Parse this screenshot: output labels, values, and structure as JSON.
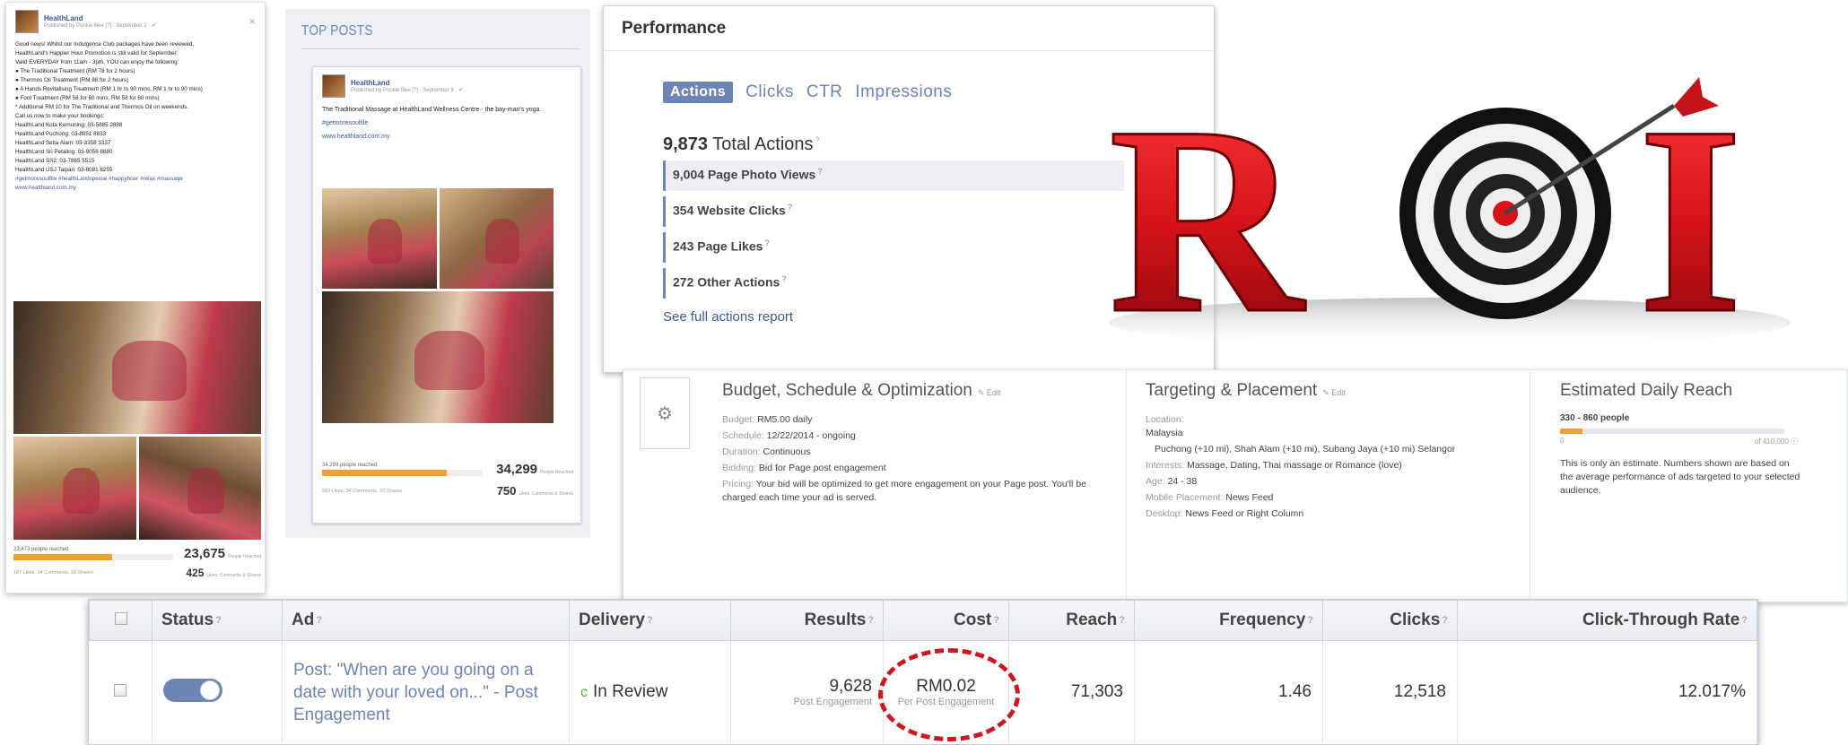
{
  "post_left": {
    "page_name": "HealthLand",
    "meta": "Published by Pookie Bee [?] · September 2 · ✔",
    "lines": [
      "Good news! Whilst our Indulgence Club packages have been reviewed,",
      "HealthLand's Happier Hour Promotion is still valid for September.",
      "Valid EVERYDAY from 11am - 3pm, YOU can enjoy the following:",
      "● The Traditional Treatment (RM 78 for 2 hours)",
      "● Thermos Oil Treatment (RM 88 for 2 hours)",
      "● A Hands Revitalising Treatment (RM 1 hr to 90 mins, RM 1 hr to 90 mins)",
      "● Foot Treatment (RM 58 for 60 mins, RM 58 for 60 mins)",
      "* Additional RM 10 for The Traditional and Thermos Oil on weekends.",
      "Call us now to make your bookings:",
      "HealthLand Kota Kemuning: 03-5885 2888",
      "HealthLand Puchong: 03-8051 8833",
      "HealthLand Setia Alam: 03-3358 3337",
      "HealthLand Sri Petaling: 03-9056 8880",
      "HealthLand SS2: 03-7865 5515",
      "HealthLand USJ Taipan: 03-8081 8255"
    ],
    "hashtags": "#getmoresoulfile #healthLandspecial #happyhour #relax #massage",
    "link": "www.healthland.com.my",
    "reached_label": "23,473 people reached",
    "big_number": "23,675",
    "big_number_caption": "People Reached",
    "small_counts": "187 Likes, 14 Comments, 18 Shares",
    "engaged_number": "425",
    "engaged_caption": "Likes, Comments & Shares",
    "reach_fill": 0.62
  },
  "top_posts": {
    "title": "TOP POSTS",
    "page_name": "HealthLand",
    "meta": "Published by Pookie Bee [?] · September 3 · ✔",
    "text": "The Traditional Massage at HealthLand Wellness Centre - the bay-man's yoga.",
    "hashtag": "#getmoresoulfile",
    "link": "www.healthland.com.my",
    "reached_label": "34,299 people reached",
    "big_number": "34,299",
    "big_number_caption": "People Reached",
    "small_counts": "583 Likes, 34 Comments, 33 Shares",
    "engaged_number": "750",
    "engaged_caption": "Likes, Comments & Shares",
    "reach_fill": 0.78
  },
  "performance": {
    "title": "Performance",
    "tabs": [
      "Actions",
      "Clicks",
      "CTR",
      "Impressions"
    ],
    "active_tab": "Actions",
    "total_value": "9,873",
    "total_label": "Total Actions",
    "actions": [
      {
        "value": "9,004",
        "label": "Page Photo Views"
      },
      {
        "value": "354",
        "label": "Website Clicks"
      },
      {
        "value": "243",
        "label": "Page Likes"
      },
      {
        "value": "272",
        "label": "Other Actions"
      }
    ],
    "see_full": "See full actions report"
  },
  "roi_logo": {
    "text": "ROI",
    "icon": "target-dart-icon",
    "red": "#d7141a"
  },
  "budget": {
    "heading": "Budget, Schedule & Optimization",
    "edit": "Edit",
    "rows": [
      {
        "k": "Budget:",
        "v": "RM5.00 daily"
      },
      {
        "k": "Schedule:",
        "v": "12/22/2014 - ongoing"
      },
      {
        "k": "Duration:",
        "v": "Continuous"
      },
      {
        "k": "Bidding:",
        "v": "Bid for Page post engagement"
      },
      {
        "k": "Pricing:",
        "v": "Your bid will be optimized to get more engagement on your Page post. You'll be charged each time your ad is served."
      }
    ]
  },
  "targeting": {
    "heading": "Targeting & Placement",
    "edit": "Edit",
    "rows": [
      {
        "k": "Location:",
        "v": "Malaysia"
      },
      {
        "k": "",
        "v": "Puchong (+10 mi), Shah Alam (+10 mi), Subang Jaya (+10 mi) Selangor"
      },
      {
        "k": "Interests:",
        "v": "Massage, Dating, Thai massage or Romance (love)"
      },
      {
        "k": "Age:",
        "v": "24 - 38"
      },
      {
        "k": "Mobile Placement:",
        "v": "News Feed"
      },
      {
        "k": "Desktop:",
        "v": "News Feed or Right Column"
      }
    ]
  },
  "reach": {
    "heading": "Estimated Daily Reach",
    "range": "330 - 860 people",
    "gauge_min": "0",
    "gauge_max": "of 410,000",
    "fill": 0.1,
    "note": "This is only an estimate. Numbers shown are based on the average performance of ads targeted to your selected audience."
  },
  "ads_table": {
    "headers": [
      "Status",
      "Ad",
      "Delivery",
      "Results",
      "Cost",
      "Reach",
      "Frequency",
      "Clicks",
      "Click-Through Rate"
    ],
    "row": {
      "ad_text": "Post: \"When are you going on a date with your loved on...\" - Post Engagement",
      "delivery": "In Review",
      "results": "9,628",
      "results_sub": "Post Engagement",
      "cost": "RM0.02",
      "cost_sub": "Per Post Engagement",
      "reach": "71,303",
      "frequency": "1.46",
      "clicks": "12,518",
      "ctr": "12.017%"
    },
    "highlight_color": "#cc1820"
  }
}
